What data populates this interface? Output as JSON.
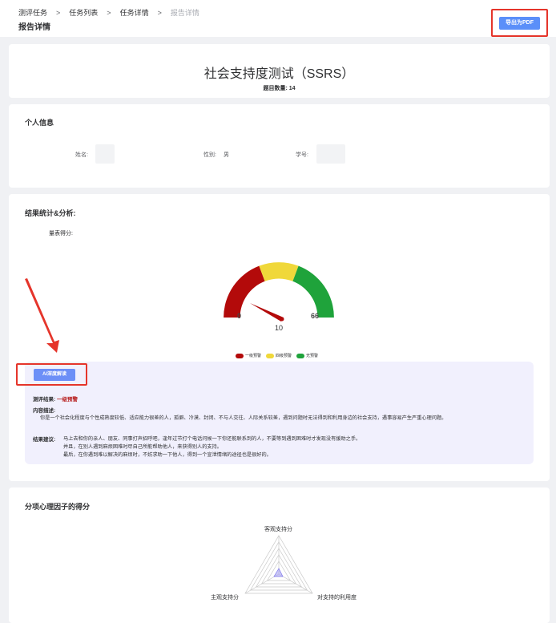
{
  "breadcrumb": {
    "items": [
      "测评任务",
      "任务列表",
      "任务详情",
      "报告详情"
    ],
    "separator": ">"
  },
  "page_title": "报告详情",
  "export_button": "导出为PDF",
  "report": {
    "title": "社会支持度测试（SSRS）",
    "question_count": "题目数量: 14"
  },
  "personal_info": {
    "section_title": "个人信息",
    "name_label": "姓名:",
    "name_value": "",
    "gender_label": "性别:",
    "gender_value": "男",
    "student_id_label": "学号:",
    "student_id_value": ""
  },
  "results": {
    "section_title": "结果统计&分析:",
    "scale_score_label": "量表得分:",
    "gauge": {
      "min": 0,
      "max": 66,
      "value": 10,
      "min_label": "0",
      "max_label": "66",
      "value_label": "10",
      "colors": {
        "red": "#b30a0a",
        "yellow": "#f0d83a",
        "green": "#1fa33b"
      }
    },
    "legend": [
      {
        "label": "一级预警",
        "color": "#b30a0a"
      },
      {
        "label": "四级预警",
        "color": "#f0d83a"
      },
      {
        "label": "无预警",
        "color": "#1fa33b"
      }
    ],
    "ai_button": "AI深度解读",
    "conclusion_label": "测评结果:",
    "conclusion_value": "一级预警",
    "desc_label": "内容描述:",
    "desc_text": "你是一个社会化程度与个性成熟度较低、适应能力很差的人，孤僻、冷漠、封闭、不与人交往、人际关系较差，遇到问题时无法得到和利用身边的社会支持，遇事容易产生严重心理问题。",
    "advice_label": "结果建议:",
    "advice_lines": [
      "马上去和你的亲人、朋友、同事打声招呼吧，逢年过节打个电话问候一下你还能联系到的人，不要等到遇到困难时才发现没有援助之手。",
      "并且，在别人遇到麻烦困难时尽自己所能帮助他人，来获得别人的支持。",
      "最后，在你遇到难以解决的麻烦时，不妨求助一下他人，得到一个宣泄情绪的途径也是很好的。"
    ]
  },
  "factors": {
    "section_title": "分项心理因子的得分",
    "radar_axes": [
      "客观支持分",
      "主观支持分",
      "对支持的利用度"
    ],
    "values": [
      0.08,
      0.06,
      0.05
    ]
  }
}
